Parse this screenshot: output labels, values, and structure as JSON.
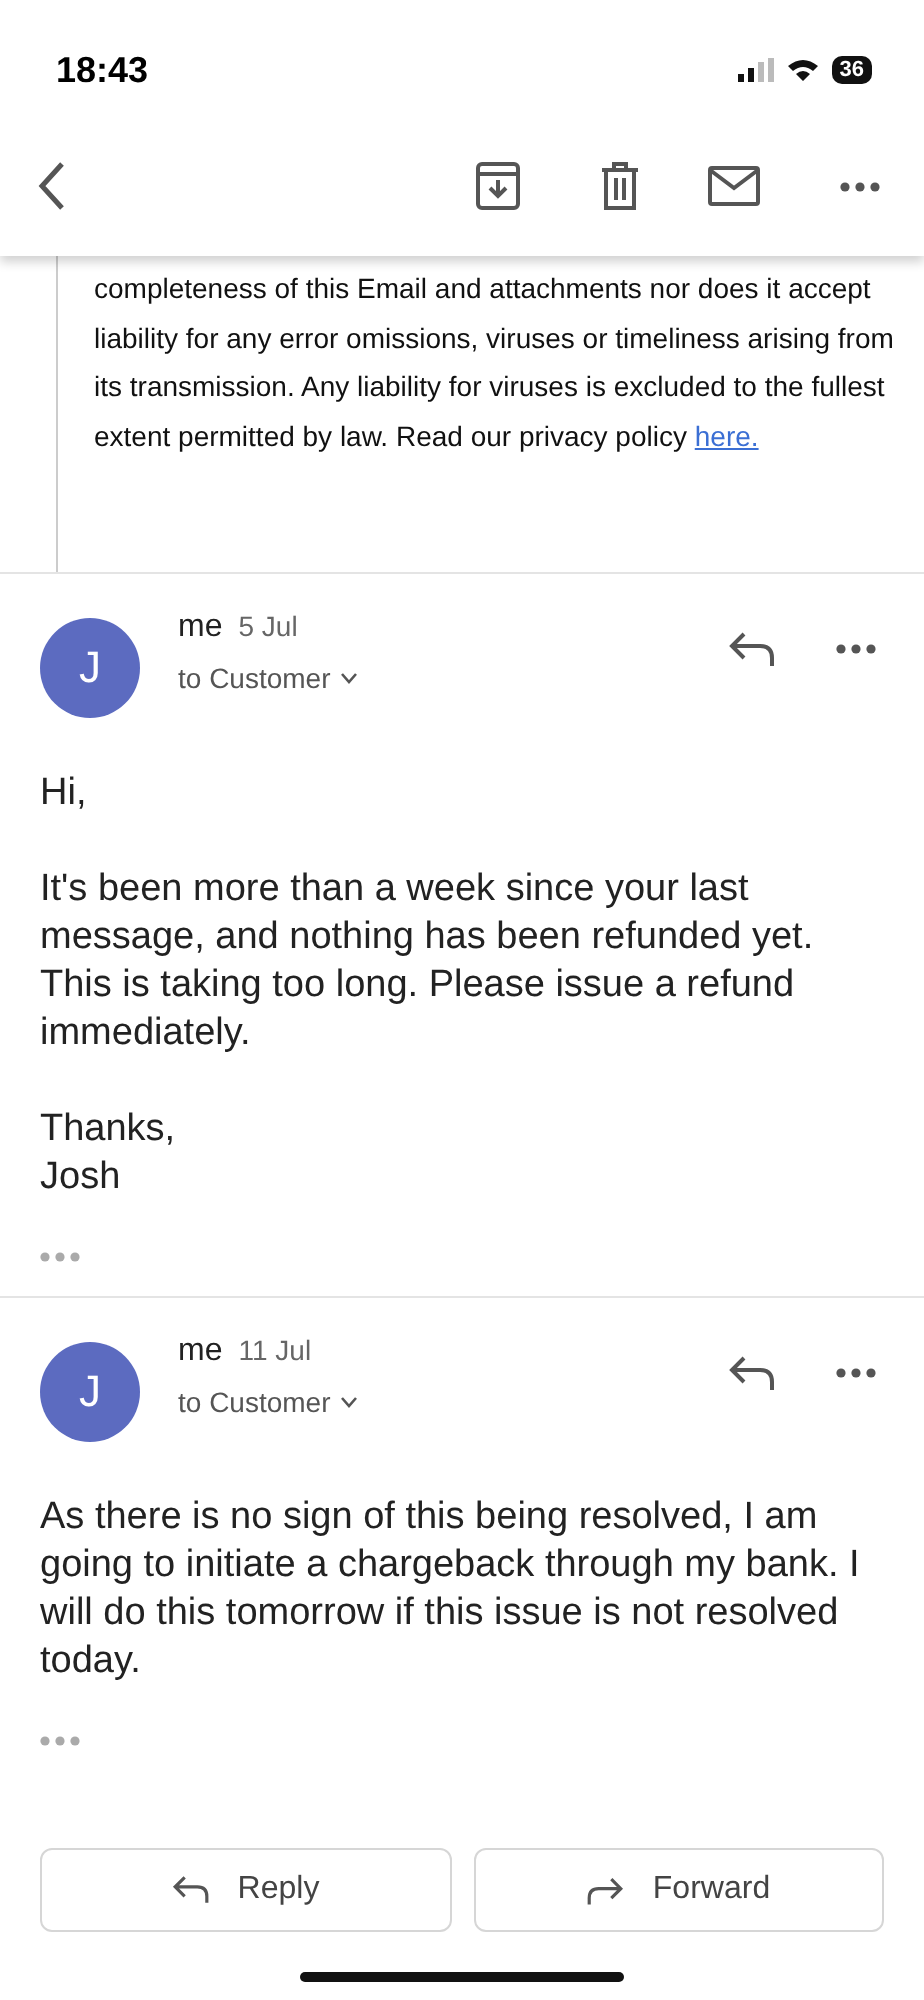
{
  "status_bar": {
    "time": "18:43",
    "battery": "36"
  },
  "quoted_text": "completeness of this Email and attachments nor does it accept liability for any error omissions, viruses or timeliness arising from its transmission. Any liability for viruses is excluded to the fullest extent permitted by law. Read our privacy policy",
  "quoted_link": "here.",
  "messages": [
    {
      "avatar": "J",
      "sender": "me",
      "date": "5 Jul",
      "recipient": "to Customer",
      "paragraphs": [
        "Hi,",
        "It's been more than a week since your last message, and nothing has been refunded yet. This is taking too long. Please issue a refund immediately.",
        "Thanks,\nJosh"
      ]
    },
    {
      "avatar": "J",
      "sender": "me",
      "date": "11 Jul",
      "recipient": "to Customer",
      "paragraphs": [
        "As there is no sign of this being resolved, I am going to initiate a chargeback through my bank. I will do this tomorrow if this issue is not resolved today."
      ]
    }
  ],
  "actions": [
    {
      "kind": "reply",
      "label": "Reply"
    },
    {
      "kind": "forward",
      "label": "Forward"
    }
  ]
}
